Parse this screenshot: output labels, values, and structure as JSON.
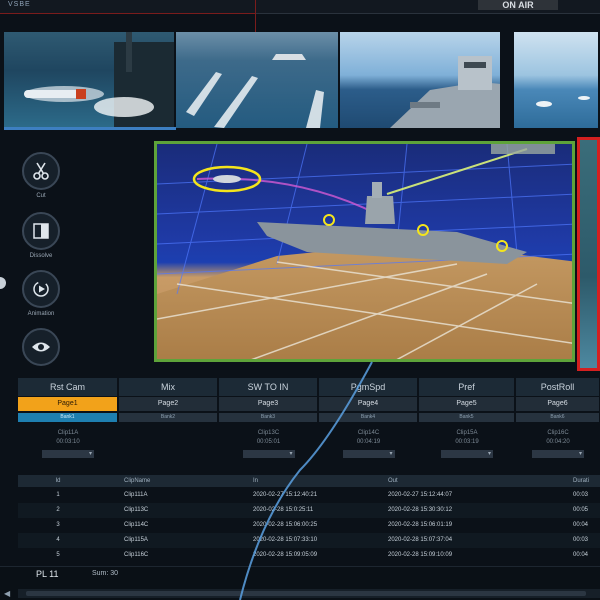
{
  "header": {
    "logo": "VSBE",
    "on_air": "ON AIR"
  },
  "thumbnails": [
    {
      "name": "thumb-torpedo-launch"
    },
    {
      "name": "thumb-boats-wakes"
    },
    {
      "name": "thumb-destroyer-deck"
    },
    {
      "name": "thumb-sea-boats"
    }
  ],
  "actions": [
    {
      "label": "Cut",
      "icon": "scissors-icon"
    },
    {
      "label": "Dissolve",
      "icon": "dissolve-icon"
    },
    {
      "label": "Animation",
      "icon": "animation-icon"
    },
    {
      "label": "",
      "icon": "eye-icon"
    }
  ],
  "tabs": [
    {
      "label": "Rst Cam",
      "page": "Page1",
      "bank": "Bank1",
      "clip": "Clip11A",
      "time": "00:03:10",
      "dropdown": "",
      "active": true
    },
    {
      "label": "Mix",
      "page": "Page2",
      "bank": "Bank2",
      "clip": "",
      "time": "",
      "dropdown": "",
      "active": false
    },
    {
      "label": "SW TO IN",
      "page": "Page3",
      "bank": "Bank3",
      "clip": "Clip13C",
      "time": "00:05:01",
      "dropdown": "",
      "active": false
    },
    {
      "label": "PgmSpd",
      "page": "Page4",
      "bank": "Bank4",
      "clip": "Clip14C",
      "time": "00:04:19",
      "dropdown": "",
      "active": false
    },
    {
      "label": "Pref",
      "page": "Page5",
      "bank": "Bank5",
      "clip": "Clip15A",
      "time": "00:03:19",
      "dropdown": "",
      "active": false
    },
    {
      "label": "PostRoll",
      "page": "Page6",
      "bank": "Bank6",
      "clip": "Clip16C",
      "time": "00:04:20",
      "dropdown": "",
      "active": false
    }
  ],
  "table": {
    "headers": {
      "id": "Id",
      "name": "ClipName",
      "in": "In",
      "out": "Out",
      "dur": "Durati"
    },
    "rows": [
      {
        "id": "1",
        "name": "Clip111A",
        "in": "2020-02-27 15:12:40:21",
        "out": "2020-02-27 15:12:44:07",
        "dur": "00:03"
      },
      {
        "id": "2",
        "name": "Clip113C",
        "in": "2020-02-28 15:0:25:11",
        "out": "2020-02-28 15:30:30:12",
        "dur": "00:05"
      },
      {
        "id": "3",
        "name": "Clip114C",
        "in": "2020-02-28 15:06:00:25",
        "out": "2020-02-28 15:06:01:19",
        "dur": "00:04"
      },
      {
        "id": "4",
        "name": "Clip115A",
        "in": "2020-02-28 15:07:33:10",
        "out": "2020-02-28 15:07:37:04",
        "dur": "00:03"
      },
      {
        "id": "5",
        "name": "Clip116C",
        "in": "2020-02-28 15:09:05:09",
        "out": "2020-02-28 15:09:10:09",
        "dur": "00:04"
      }
    ]
  },
  "status": {
    "playlist": "PL 11",
    "sum": "Sum:  30"
  },
  "colors": {
    "active_page": "#f2a21a",
    "active_bank": "#1e7fb0",
    "preview_border": "#5ea33a",
    "program_border": "#d42020"
  }
}
